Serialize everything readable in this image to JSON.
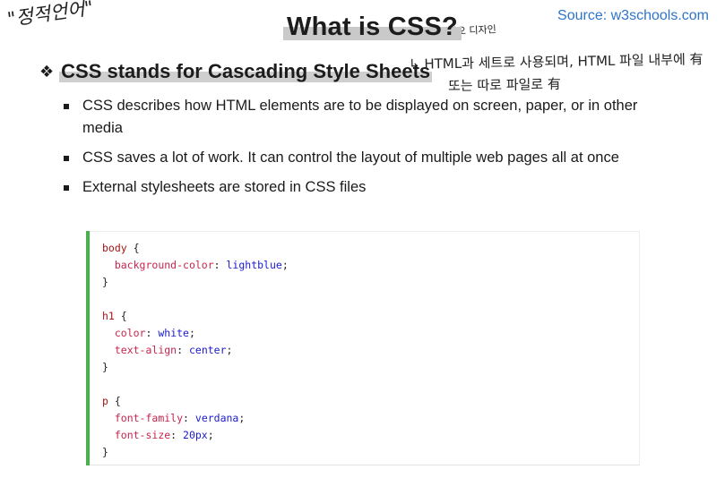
{
  "handwriting": {
    "top_left": "\"정적언어\"",
    "note_title": "↘ 각오 디자인",
    "note_line1": "↳ HTML과 세트로 사용되며, HTML 파일 내부에 有",
    "note_line2": "또는 따로 파일로 有"
  },
  "header": {
    "title": "What is CSS?",
    "source": "Source: w3schools.com"
  },
  "section": {
    "bullet_glyph": "❖",
    "heading": "CSS stands for Cascading Style Sheets"
  },
  "bullets": [
    "CSS describes how HTML elements are to be displayed on screen, paper, or in other media",
    "CSS saves a lot of work. It can control the layout of multiple web pages all at once",
    "External stylesheets are stored in CSS files"
  ],
  "code": {
    "accent_color": "#4caf50",
    "blocks": [
      {
        "selector": "body",
        "rules": [
          {
            "property": "background-color",
            "value": "lightblue"
          }
        ]
      },
      {
        "selector": "h1",
        "rules": [
          {
            "property": "color",
            "value": "white"
          },
          {
            "property": "text-align",
            "value": "center"
          }
        ]
      },
      {
        "selector": "p",
        "rules": [
          {
            "property": "font-family",
            "value": "verdana"
          },
          {
            "property": "font-size",
            "value": "20px"
          }
        ]
      }
    ]
  },
  "colors": {
    "source_link": "#2e74c9",
    "highlight": "#c9c9c9",
    "selector": "#a31515",
    "property": "#c7254e",
    "value": "#1a1ad0"
  }
}
